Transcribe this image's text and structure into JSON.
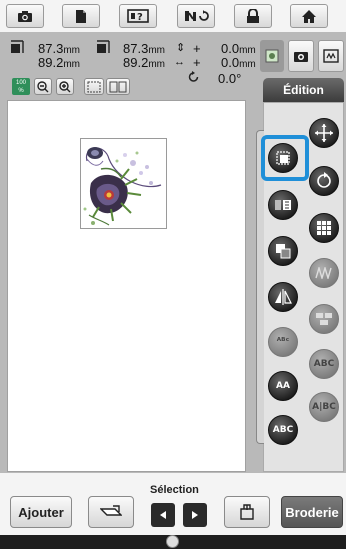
{
  "toolbar": {
    "buttons": [
      "camera-icon",
      "document-icon",
      "help-icon",
      "thread-tension-icon",
      "lock-icon",
      "home-icon"
    ]
  },
  "dimensions": {
    "width_main": "87.3",
    "height_main": "89.2",
    "width_alt": "87.3",
    "height_alt": "89.2",
    "unit": "mm",
    "offset_v": "0.0",
    "offset_h": "0.0",
    "offset_v_sign": "+",
    "offset_h_sign": "+",
    "angle": "0.0°"
  },
  "zoom": {
    "level_label": "100\n%"
  },
  "tabs": {
    "edit_label": "Édition"
  },
  "bottom": {
    "add_label": "Ajouter",
    "selection_label": "Sélection",
    "embroider_label": "Broderie"
  },
  "colors": {
    "accent": "#1f8fd8",
    "tool_active": "#1c1c1c",
    "tool_disabled": "#7c7c7c"
  }
}
